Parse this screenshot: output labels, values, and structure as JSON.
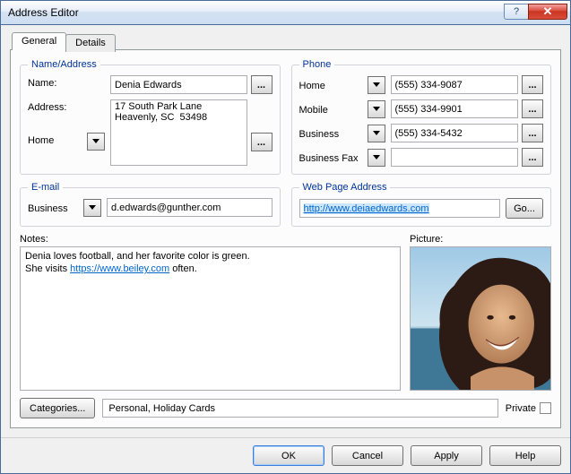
{
  "window": {
    "title": "Address Editor"
  },
  "titlebar_buttons": {
    "help": "?",
    "close": "✕"
  },
  "tabs": {
    "general": "General",
    "details": "Details"
  },
  "group_labels": {
    "name_address": "Name/Address",
    "phone": "Phone",
    "email": "E-mail",
    "web": "Web Page Address"
  },
  "name_address": {
    "name_label": "Name:",
    "address_label": "Address:",
    "type_label": "Home",
    "name_value": "Denia Edwards",
    "address_value": "17 South Park Lane\nHeavenly, SC  53498"
  },
  "phone": {
    "rows": [
      {
        "label": "Home",
        "value": "(555) 334-9087"
      },
      {
        "label": "Mobile",
        "value": "(555) 334-9901"
      },
      {
        "label": "Business",
        "value": "(555) 334-5432"
      },
      {
        "label": "Business Fax",
        "value": ""
      }
    ]
  },
  "email": {
    "type_label": "Business",
    "value": "d.edwards@gunther.com"
  },
  "web": {
    "url": "http://www.deiaedwards.com",
    "go_label": "Go..."
  },
  "notes": {
    "label": "Notes:",
    "line1_prefix": "Denia loves football, and her favorite color is green.",
    "line2_prefix": "She visits ",
    "line2_link": "https://www.beiley.com",
    "line2_suffix": " often."
  },
  "picture": {
    "label": "Picture:"
  },
  "categories": {
    "button": "Categories...",
    "value": "Personal, Holiday Cards",
    "private_label": "Private"
  },
  "dlg_buttons": {
    "ok": "OK",
    "cancel": "Cancel",
    "apply": "Apply",
    "help": "Help"
  },
  "ellipsis": "..."
}
